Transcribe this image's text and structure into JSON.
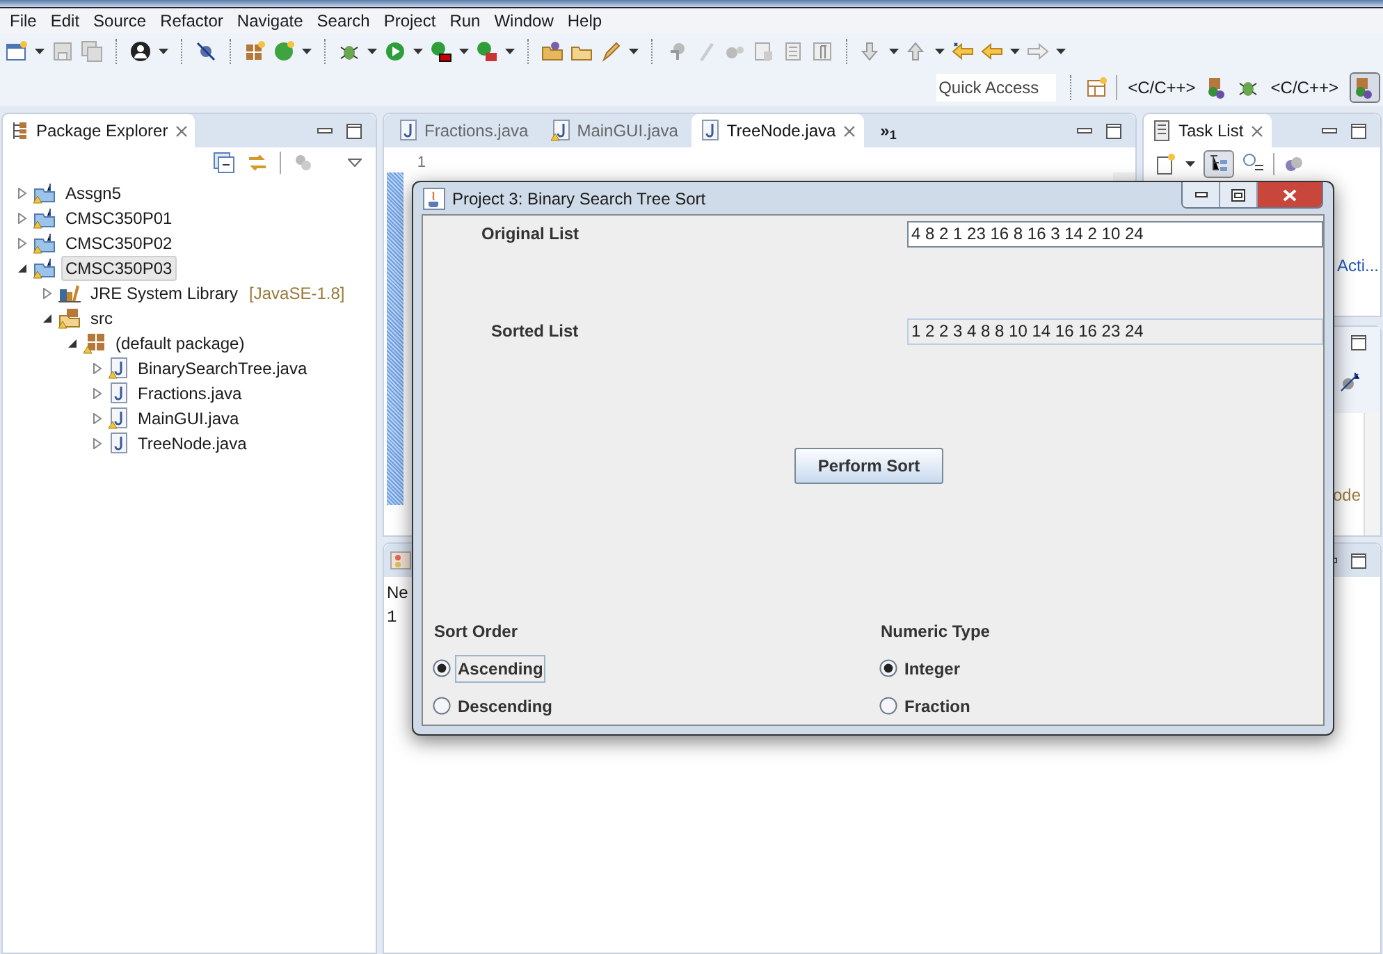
{
  "menu": [
    "File",
    "Edit",
    "Source",
    "Refactor",
    "Navigate",
    "Search",
    "Project",
    "Run",
    "Window",
    "Help"
  ],
  "quick_access": {
    "placeholder": "Quick Access"
  },
  "perspectives": [
    {
      "label": "<C/C++>"
    },
    {
      "label": "<C/C++>"
    }
  ],
  "package_explorer": {
    "title": "Package Explorer",
    "tree": [
      {
        "label": "Assgn5",
        "kind": "project",
        "expanded": false,
        "selected": false
      },
      {
        "label": "CMSC350P01",
        "kind": "project",
        "expanded": false,
        "selected": false
      },
      {
        "label": "CMSC350P02",
        "kind": "project",
        "expanded": false,
        "selected": false
      },
      {
        "label": "CMSC350P03",
        "kind": "project",
        "expanded": true,
        "selected": true,
        "children": [
          {
            "label": "JRE System Library",
            "suffix": "[JavaSE-1.8]",
            "kind": "library",
            "expanded": false,
            "selected": false
          },
          {
            "label": "src",
            "kind": "folder",
            "expanded": true,
            "selected": false,
            "children": [
              {
                "label": "(default package)",
                "kind": "package",
                "expanded": true,
                "selected": false,
                "children": [
                  {
                    "label": "BinarySearchTree.java",
                    "kind": "java",
                    "warning": true,
                    "expanded": false,
                    "selected": false
                  },
                  {
                    "label": "Fractions.java",
                    "kind": "java",
                    "warning": false,
                    "expanded": false,
                    "selected": false
                  },
                  {
                    "label": "MainGUI.java",
                    "kind": "java",
                    "warning": true,
                    "expanded": false,
                    "selected": false
                  },
                  {
                    "label": "TreeNode.java",
                    "kind": "java",
                    "warning": false,
                    "expanded": false,
                    "selected": false
                  }
                ]
              }
            ]
          }
        ]
      }
    ]
  },
  "editor": {
    "tabs": [
      {
        "label": "Fractions.java",
        "selected": false
      },
      {
        "label": "MainGUI.java",
        "selected": false
      },
      {
        "label": "TreeNode.java",
        "selected": true
      }
    ],
    "overflow": "»$_{1}$",
    "line_number": "1"
  },
  "task_list": {
    "title": "Task List",
    "link": "Acti..."
  },
  "outline_fragment": "ode",
  "console": {
    "column_fragment": "Ne",
    "line": "1"
  },
  "dialog": {
    "title": "Project 3: Binary Search Tree Sort",
    "original_label": "Original List",
    "original_value": "4 8 2 1 23 16 8 16 3 14 2 10 24",
    "sorted_label": "Sorted List",
    "sorted_value": "1 2 2 3 4 8 8 10 14 16 16 23 24",
    "button": "Perform Sort",
    "groups": [
      {
        "title": "Sort Order",
        "options": [
          {
            "label": "Ascending",
            "selected": true,
            "focused": true
          },
          {
            "label": "Descending",
            "selected": false,
            "focused": false
          }
        ]
      },
      {
        "title": "Numeric Type",
        "options": [
          {
            "label": "Integer",
            "selected": true,
            "focused": false
          },
          {
            "label": "Fraction",
            "selected": false,
            "focused": false
          }
        ]
      }
    ]
  }
}
